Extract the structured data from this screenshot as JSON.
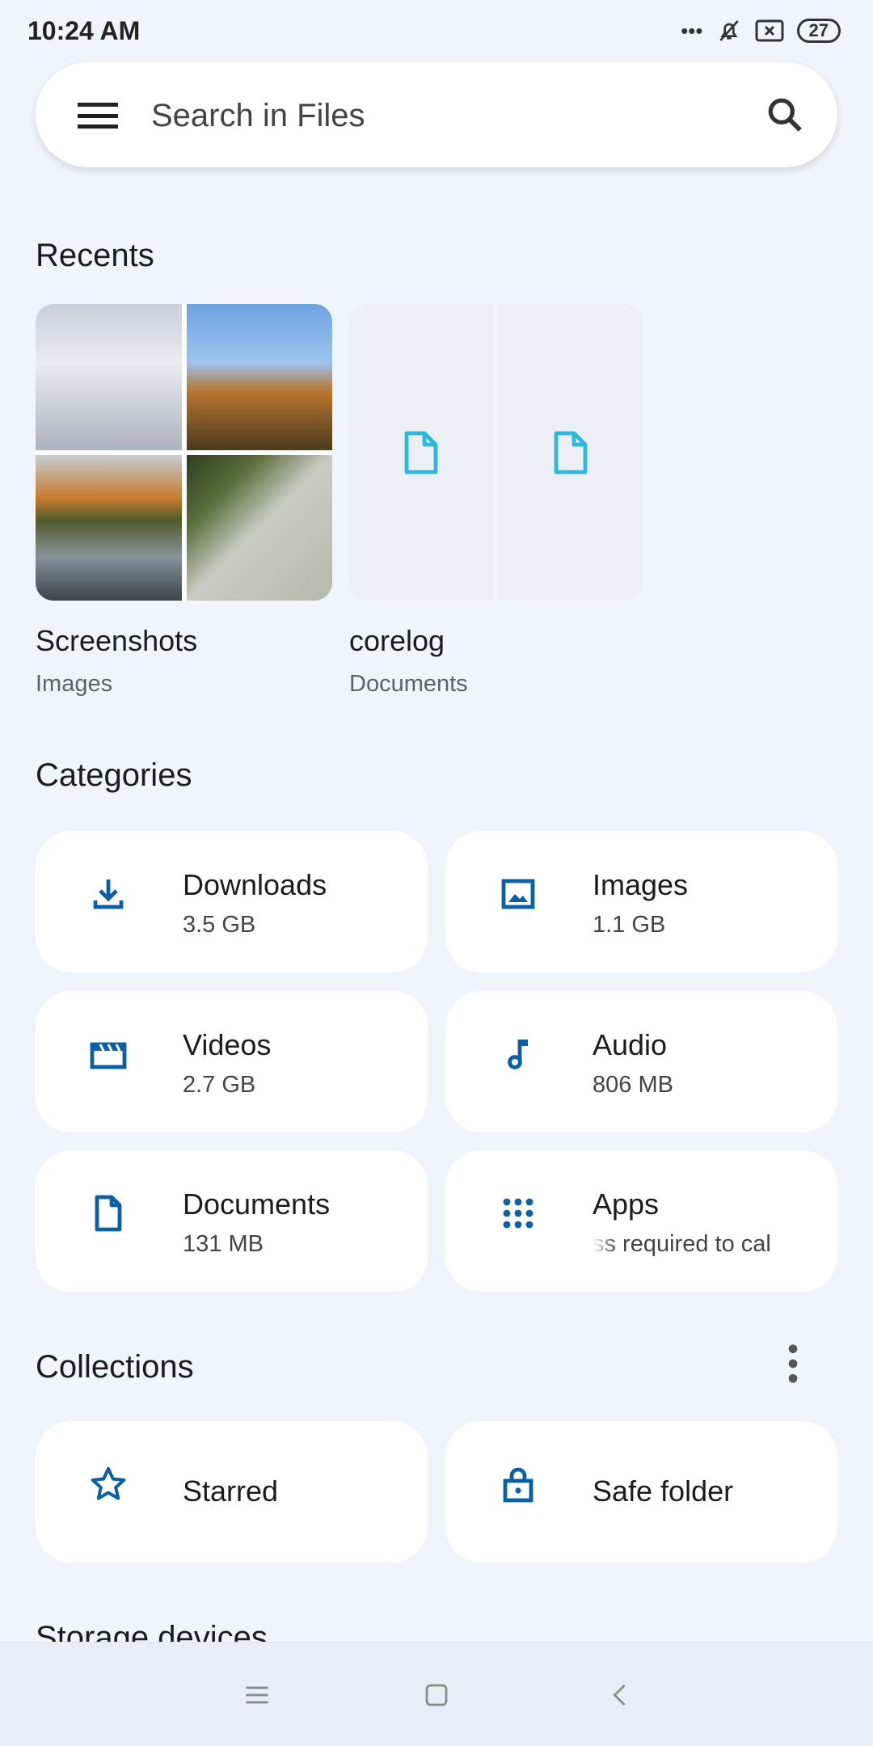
{
  "status_bar": {
    "time": "10:24 AM",
    "battery": "27",
    "icons": [
      "more-dots-icon",
      "bell-off-icon",
      "sim-none-icon",
      "battery-icon"
    ]
  },
  "search": {
    "placeholder": "Search in Files"
  },
  "recents": {
    "title": "Recents",
    "items": [
      {
        "name": "Screenshots",
        "type": "Images"
      },
      {
        "name": "corelog",
        "type": "Documents"
      }
    ]
  },
  "categories": {
    "title": "Categories",
    "items": [
      {
        "label": "Downloads",
        "size": "3.5 GB",
        "icon": "download-icon"
      },
      {
        "label": "Images",
        "size": "1.1 GB",
        "icon": "image-icon"
      },
      {
        "label": "Videos",
        "size": "2.7 GB",
        "icon": "video-icon"
      },
      {
        "label": "Audio",
        "size": "806 MB",
        "icon": "music-note-icon"
      },
      {
        "label": "Documents",
        "size": "131 MB",
        "icon": "document-icon"
      },
      {
        "label": "Apps",
        "size": "ss required to cal",
        "icon": "apps-grid-icon"
      }
    ]
  },
  "collections": {
    "title": "Collections",
    "items": [
      {
        "label": "Starred",
        "icon": "star-icon"
      },
      {
        "label": "Safe folder",
        "icon": "lock-icon"
      }
    ]
  },
  "storage": {
    "title": "Storage devices"
  },
  "accent": "#0b5fa5",
  "doc_icon_color": "#2bb8dc"
}
